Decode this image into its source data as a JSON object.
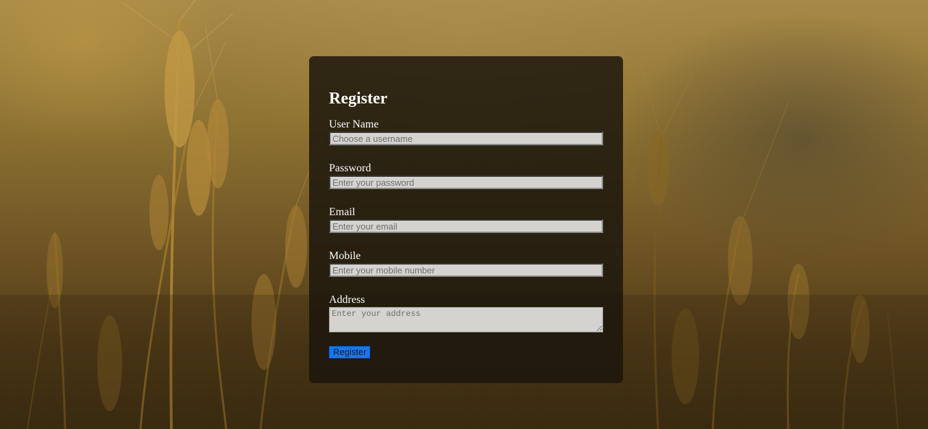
{
  "form": {
    "title": "Register",
    "fields": [
      {
        "label": "User Name",
        "placeholder": "Choose a username",
        "value": ""
      },
      {
        "label": "Password",
        "placeholder": "Enter your password",
        "value": ""
      },
      {
        "label": "Email",
        "placeholder": "Enter your email",
        "value": ""
      },
      {
        "label": "Mobile",
        "placeholder": "Enter your mobile number",
        "value": ""
      },
      {
        "label": "Address",
        "placeholder": "Enter your address",
        "value": ""
      }
    ],
    "submit_label": "Register"
  },
  "colors": {
    "card_background": "#1a150c",
    "input_background": "#d5d3cf",
    "button_background": "#1677ef",
    "background_tone": "#8f7333"
  },
  "background": {
    "description_icon": "wheat-field-image"
  }
}
